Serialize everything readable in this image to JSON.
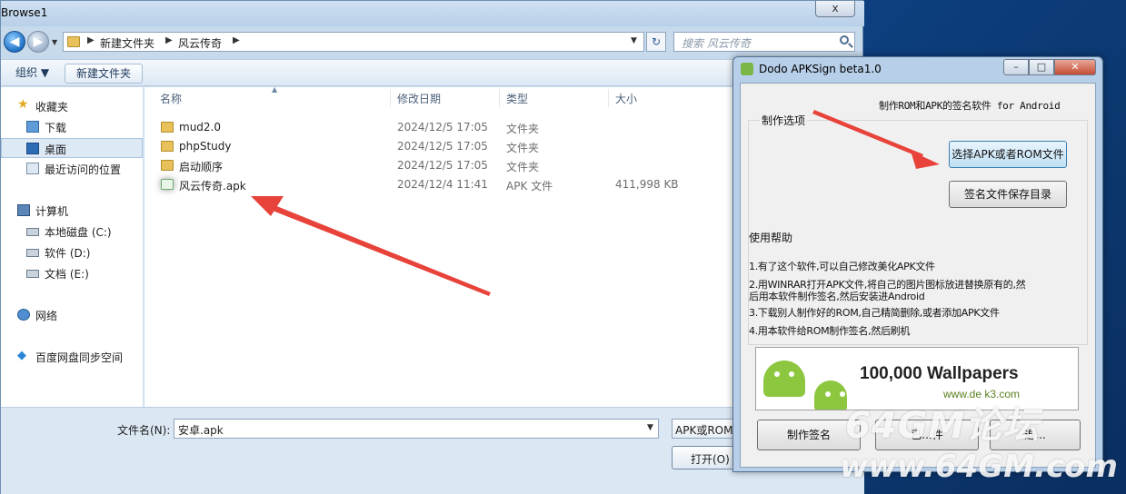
{
  "browse": {
    "title": "Browse1",
    "close": "x",
    "address": {
      "crumbs": [
        "新建文件夹",
        "风云传奇"
      ]
    },
    "search_placeholder": "搜索 风云传奇",
    "toolbar": {
      "organize": "组织 ▼",
      "new_folder": "新建文件夹"
    },
    "nav": [
      {
        "label": "收藏夹",
        "icon": "star-icon"
      },
      {
        "label": "下载",
        "icon": "download-folder-icon"
      },
      {
        "label": "桌面",
        "icon": "desktop-icon",
        "selected": true
      },
      {
        "label": "最近访问的位置",
        "icon": "recent-places-icon"
      },
      {
        "label": "计算机",
        "icon": "computer-icon"
      },
      {
        "label": "本地磁盘 (C:)",
        "icon": "drive-icon"
      },
      {
        "label": "软件 (D:)",
        "icon": "drive-icon"
      },
      {
        "label": "文档 (E:)",
        "icon": "drive-icon"
      },
      {
        "label": "网络",
        "icon": "network-icon"
      },
      {
        "label": "百度网盘同步空间",
        "icon": "cloud-icon"
      }
    ],
    "columns": [
      "名称",
      "修改日期",
      "类型",
      "大小"
    ],
    "files": [
      {
        "name": "mud2.0",
        "date": "2024/12/5 17:05",
        "type": "文件夹",
        "size": "",
        "kind": "folder"
      },
      {
        "name": "phpStudy",
        "date": "2024/12/5 17:05",
        "type": "文件夹",
        "size": "",
        "kind": "folder"
      },
      {
        "name": "启动顺序",
        "date": "2024/12/5 17:05",
        "type": "文件夹",
        "size": "",
        "kind": "folder"
      },
      {
        "name": "风云传奇.apk",
        "date": "2024/12/4 11:41",
        "type": "APK 文件",
        "size": "411,998 KB",
        "kind": "apk"
      }
    ],
    "filename_label": "文件名(N):",
    "filename_value": "安卓.apk",
    "filetype_value": "APK或ROM",
    "open_button": "打开(O)"
  },
  "apksign": {
    "title": "Dodo APKSign beta1.0",
    "subtitle": "制作ROM和APK的签名软件 for Android",
    "group_title": "制作选项",
    "btn_select": "选择APK或者ROM文件",
    "btn_savedir": "签名文件保存目录",
    "help_title": "使用帮助",
    "help_lines": [
      "1.有了这个软件,可以自己修改美化APK文件",
      "2.用WINRAR打开APK文件,将自己的图片图标放进替换原有的,然",
      "后用本软件制作签名,然后安装进Android",
      "3.下载别人制作好的ROM,自己精简删除,或者添加APK文件",
      "4.用本软件给ROM制作签名,然后刷机"
    ],
    "banner_text": "100,000 Wallpapers",
    "banner_url": "www.de k3.com",
    "bottom_buttons": [
      "制作签名",
      "已...件",
      "退..."
    ]
  },
  "watermark": {
    "line1": "64GM论坛",
    "line2": "www.64GM.com"
  }
}
